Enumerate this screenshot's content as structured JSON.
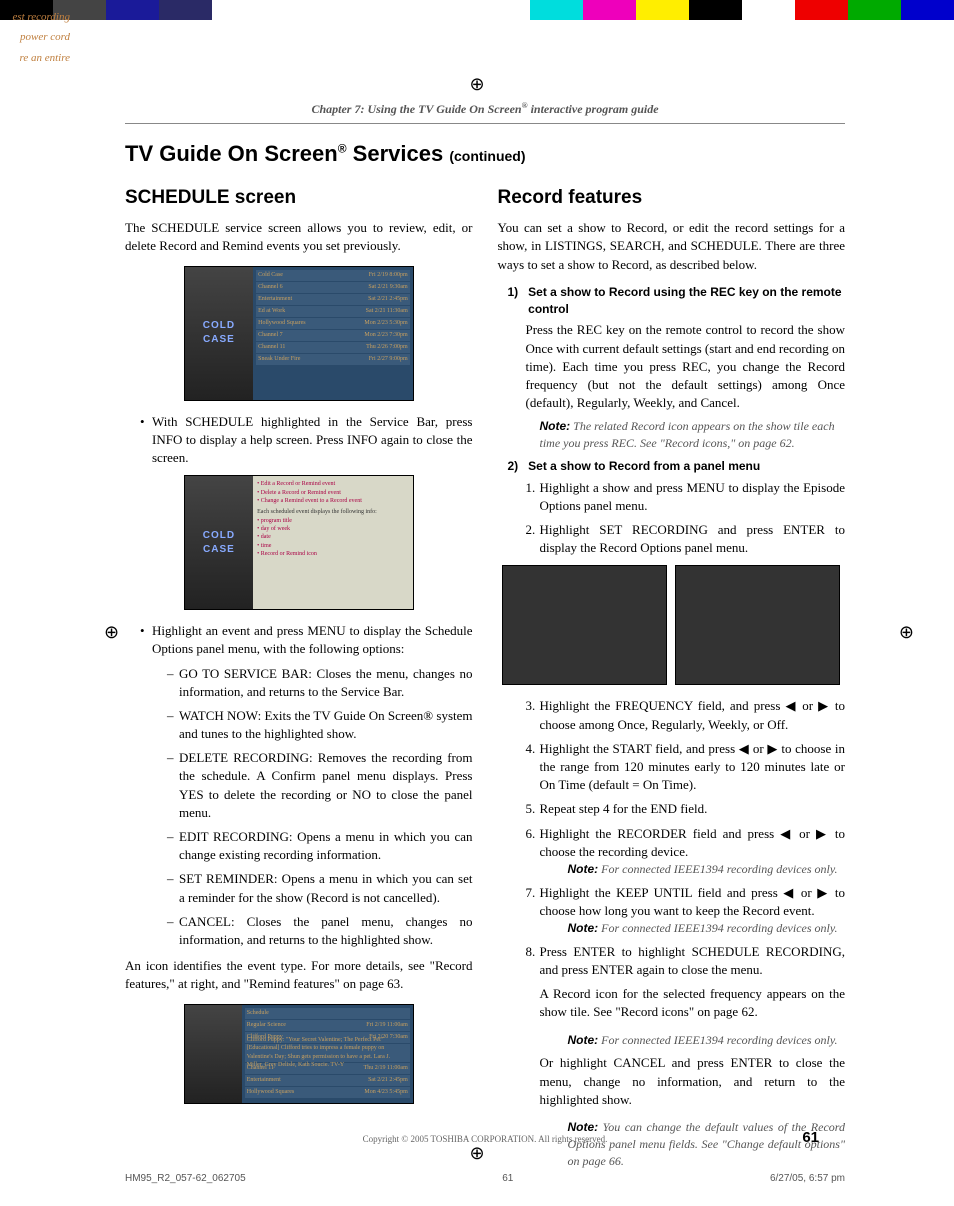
{
  "header": {
    "side_text_1": "est recording",
    "side_text_2": "power cord",
    "side_text_3": "re an entire",
    "chapter": "Chapter 7: Using the TV Guide On Screen",
    "chapter_suffix": " interactive program guide",
    "title_pre": "TV Guide On Screen",
    "title_post": " Services ",
    "continued": "(continued)"
  },
  "left": {
    "heading": "SCHEDULE screen",
    "intro": "The SCHEDULE service screen allows you to review, edit, or delete Record and Remind events you set previously.",
    "bullet1": "With SCHEDULE highlighted in the Service Bar, press INFO to display a help screen. Press INFO again to close the screen.",
    "bullet2_intro": "Highlight an event and press MENU to display the Schedule Options panel menu, with the following options:",
    "opt1": "GO TO SERVICE BAR: Closes the menu, changes no information, and returns to the Service Bar.",
    "opt2": "WATCH NOW: Exits the TV Guide On Screen® system and tunes to the highlighted show.",
    "opt3": "DELETE RECORDING: Removes the recording from the schedule. A Confirm panel menu displays. Press YES to delete the recording or NO to close the panel menu.",
    "opt4": "EDIT RECORDING: Opens a menu in which you can change existing recording information.",
    "opt5": "SET REMINDER: Opens a menu in which you can set a reminder for the show (Record is not cancelled).",
    "opt6": "CANCEL: Closes the panel menu, changes no information, and returns to the highlighted show.",
    "tail": "An icon identifies the event type. For more details, see \"Record features,\" at right, and \"Remind features\" on page 63."
  },
  "right": {
    "heading": "Record features",
    "intro": "You can set a show to Record, or edit the record settings for a show, in LISTINGS, SEARCH, and SCHEDULE. There are three ways to set a show to Record, as described below.",
    "h1_num": "1)",
    "h1": "Set a show to Record using the REC key on the remote control",
    "h1_p": "Press the REC key on the remote control to record the show Once with current default settings (start and end recording on time). Each time you press REC, you change the Record frequency (but not the default settings) among Once (default), Regularly, Weekly, and Cancel.",
    "h1_note": "The related Record icon appears on the show tile each time you press REC. See \"Record icons,\" on page 62.",
    "h2_num": "2)",
    "h2": "Set a show to Record from a panel menu",
    "step1": "Highlight a show and press MENU to display the Episode Options panel menu.",
    "step2": "Highlight SET RECORDING and press ENTER to display the Record Options panel menu.",
    "step3": "Highlight the FREQUENCY field, and press ◀ or ▶ to choose among Once, Regularly, Weekly, or Off.",
    "step4": "Highlight the START field, and press ◀ or ▶ to choose in the range from 120 minutes early to 120 minutes late or On Time (default = On Time).",
    "step5": "Repeat step 4 for the END field.",
    "step6": "Highlight the RECORDER field and press ◀ or ▶ to choose the recording device.",
    "step6_note": "For connected IEEE1394 recording devices only.",
    "step7": "Highlight the KEEP UNTIL field and press ◀ or ▶ to choose how long you want to keep the Record event.",
    "step7_note": "For connected IEEE1394 recording devices only.",
    "step8": "Press ENTER to highlight SCHEDULE RECORDING, and press ENTER again to close the menu.",
    "step8_p1": "A Record icon for the selected frequency appears on the show tile. See \"Record icons\" on page 62.",
    "step8_note1": "For connected IEEE1394 recording devices only.",
    "step8_p2": "Or highlight CANCEL and press ENTER to close the menu, change no information, and return to the highlighted show.",
    "step8_note2": "You can change the default values of the Record Options panel menu fields. See \"Change default options\" on page 66."
  },
  "footer": {
    "copyright": "Copyright © 2005 TOSHIBA CORPORATION. All rights reserved.",
    "page_num": "61",
    "file": "HM95_R2_057-62_062705",
    "page": "61",
    "date": "6/27/05, 6:57 pm"
  },
  "note_label": "Note:",
  "color_bar": [
    "#000",
    "#333",
    "#666",
    "#1a1a66",
    "#fff",
    "#fff",
    "#fff",
    "#fff",
    "#fff",
    "#fff",
    "#0ff",
    "#f08",
    "#ff0",
    "#000",
    "#fff",
    "#f00",
    "#0c0",
    "#00f"
  ]
}
